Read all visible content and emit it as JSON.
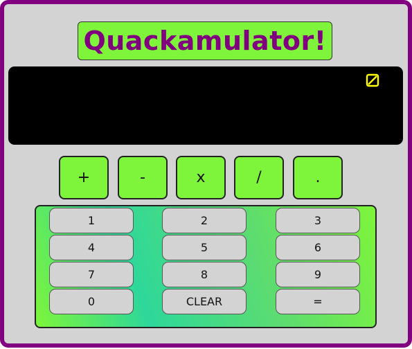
{
  "app": {
    "title": "Quackamulator!"
  },
  "display": {
    "value": "",
    "icon": "no-value-icon"
  },
  "operators": [
    "+",
    "-",
    "x",
    "/",
    "."
  ],
  "keypad": {
    "keys": [
      "1",
      "2",
      "3",
      "4",
      "5",
      "6",
      "7",
      "8",
      "9",
      "0",
      "CLEAR",
      "="
    ]
  },
  "colors": {
    "frame": "#800080",
    "background": "#d3d3d3",
    "accent_green": "#7ef53a",
    "title_text": "#800080",
    "display_bg": "#000000",
    "display_icon": "#ffff00",
    "keypad_gradient_mid": "#2ed89a"
  }
}
